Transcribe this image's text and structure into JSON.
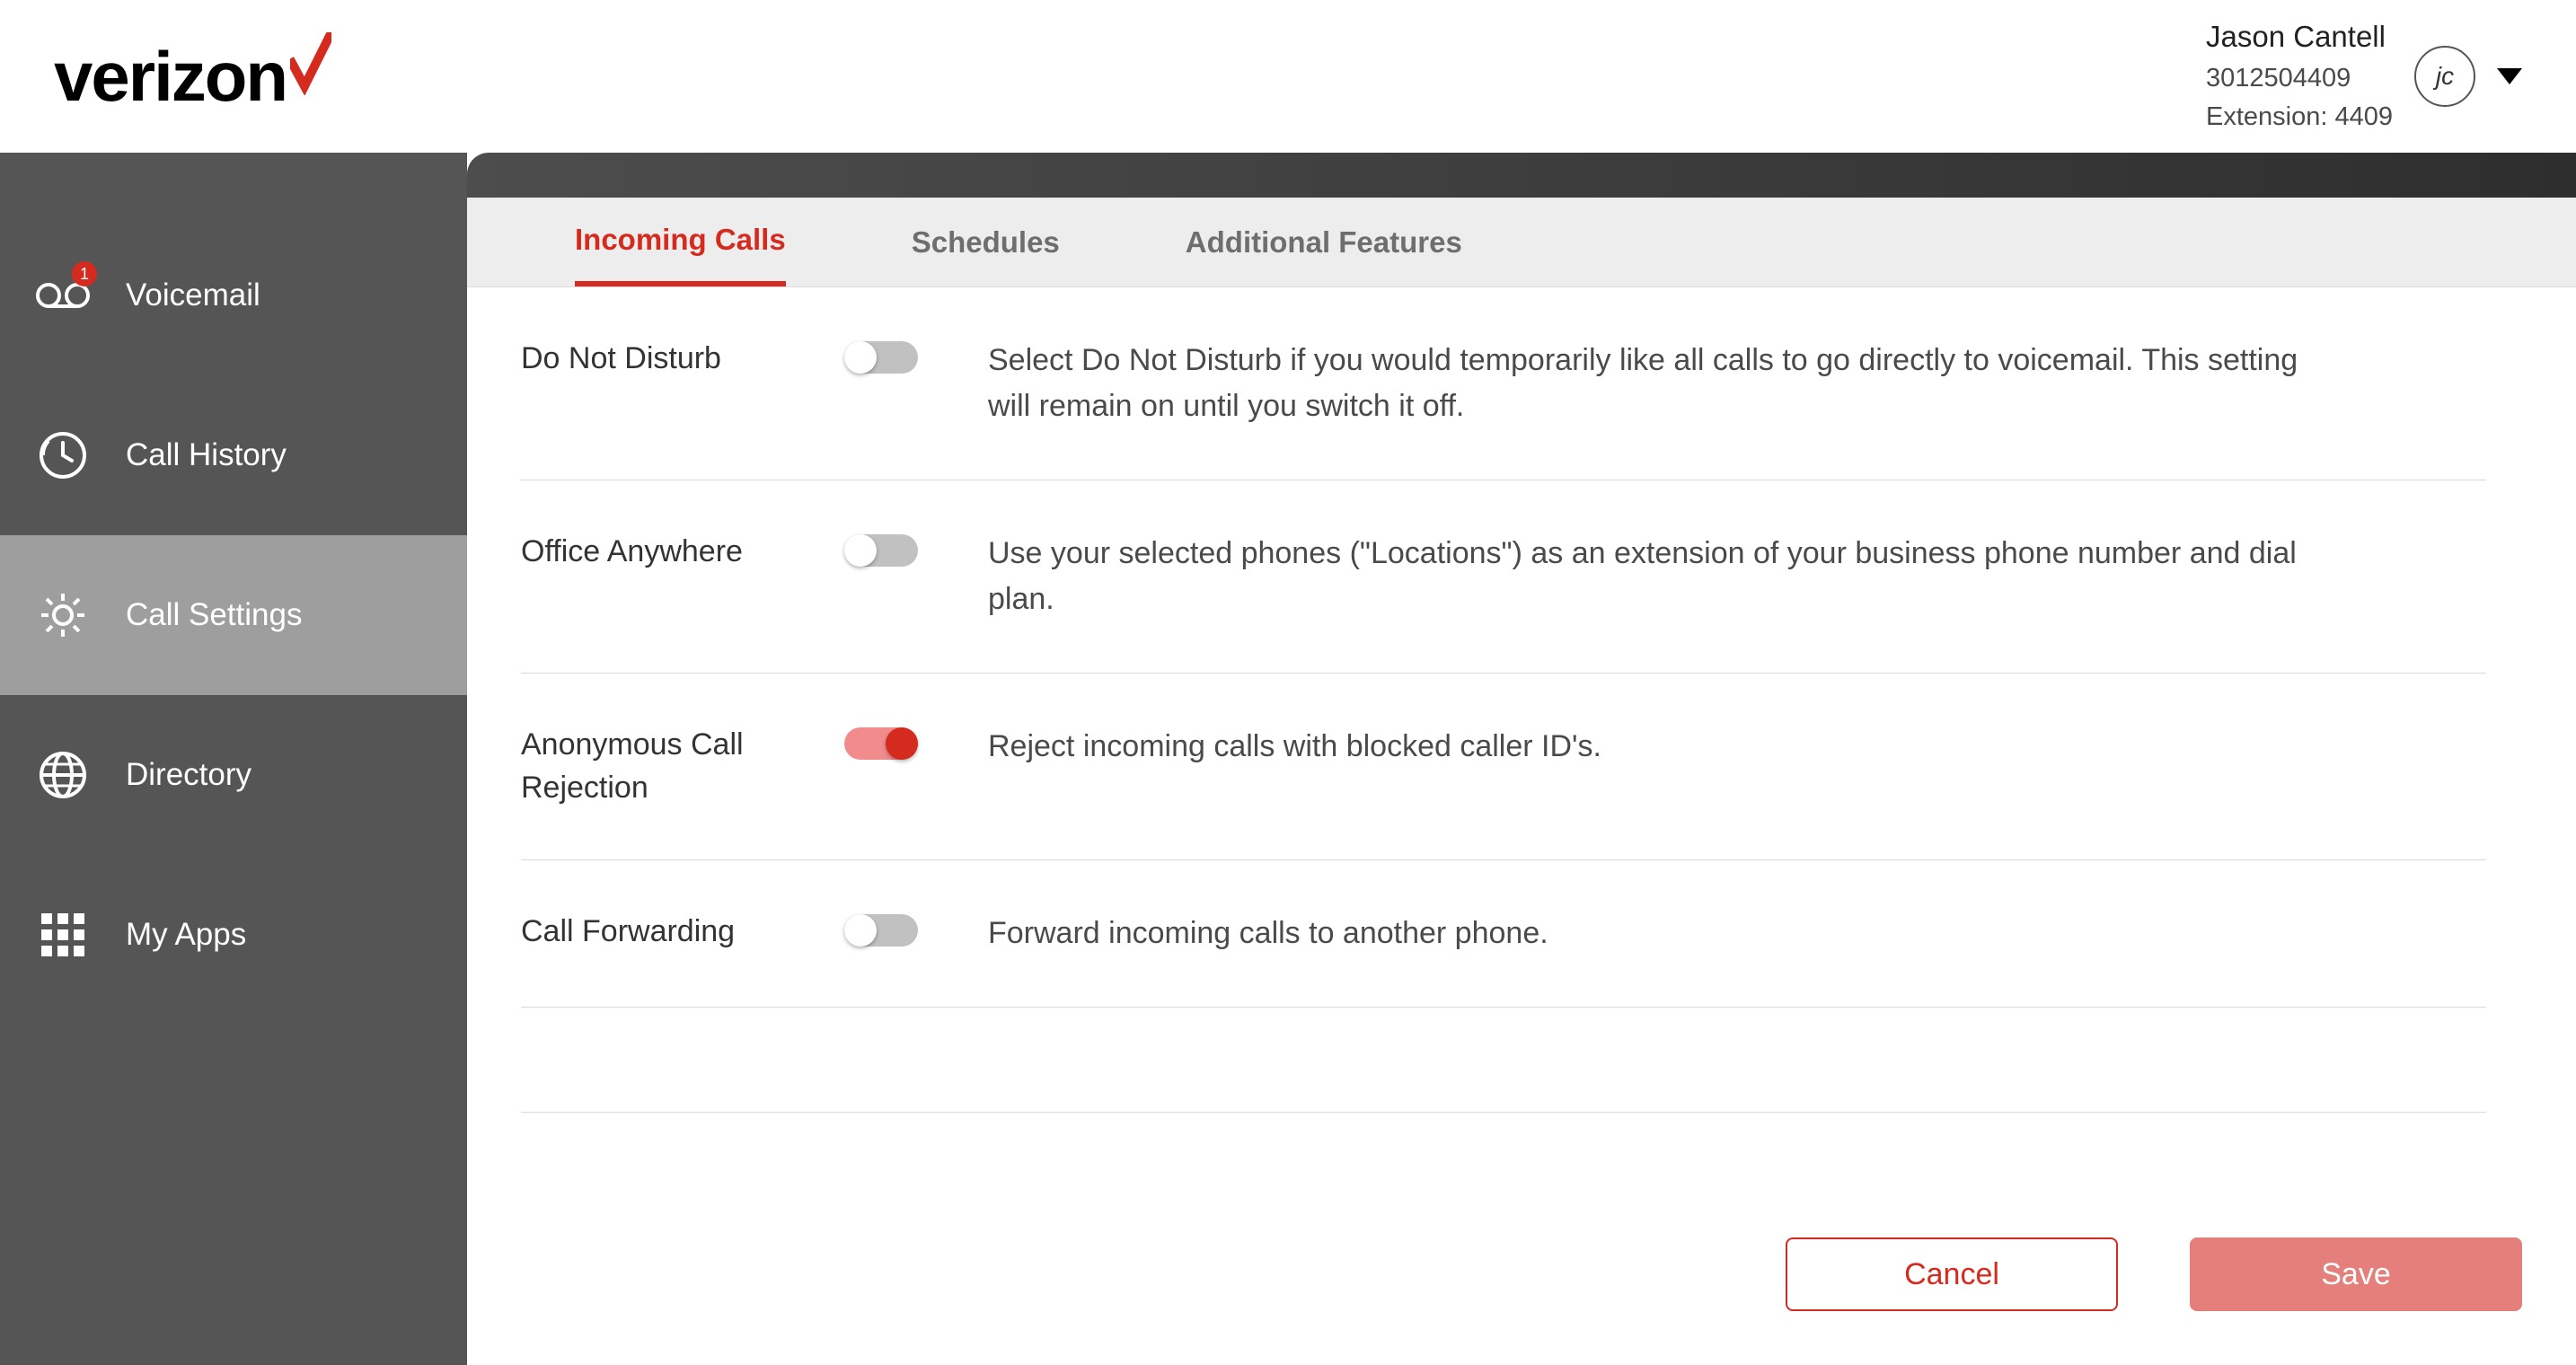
{
  "header": {
    "brand": "verizon",
    "user_name": "Jason Cantell",
    "user_phone": "3012504409",
    "user_ext": "Extension: 4409",
    "avatar_initials": "jc"
  },
  "sidebar": {
    "items": [
      {
        "label": "Voicemail",
        "icon": "voicemail-icon",
        "badge": "1"
      },
      {
        "label": "Call History",
        "icon": "history-icon",
        "badge": null
      },
      {
        "label": "Call Settings",
        "icon": "gear-icon",
        "badge": null,
        "active": true
      },
      {
        "label": "Directory",
        "icon": "globe-icon",
        "badge": null
      },
      {
        "label": "My Apps",
        "icon": "apps-icon",
        "badge": null
      }
    ]
  },
  "tabs": [
    {
      "label": "Incoming Calls",
      "active": true
    },
    {
      "label": "Schedules",
      "active": false
    },
    {
      "label": "Additional Features",
      "active": false
    }
  ],
  "settings": [
    {
      "label": "Do Not Disturb",
      "on": false,
      "desc": "Select Do Not Disturb if you would temporarily like all calls to go directly to voicemail. This setting will remain on until you switch it off."
    },
    {
      "label": "Office Anywhere",
      "on": false,
      "desc": "Use your selected phones (\"Locations\") as an extension of your business phone number and dial plan."
    },
    {
      "label": "Anonymous Call Rejection",
      "on": true,
      "desc": "Reject incoming calls with blocked caller ID's."
    },
    {
      "label": "Call Forwarding",
      "on": false,
      "desc": "Forward incoming calls to another phone."
    },
    {
      "label": "",
      "on": false,
      "desc": ""
    }
  ],
  "footer": {
    "cancel": "Cancel",
    "save": "Save"
  },
  "colors": {
    "brand_red": "#d52b1e",
    "sidebar_bg": "#555555",
    "sidebar_active": "#9e9e9e"
  }
}
